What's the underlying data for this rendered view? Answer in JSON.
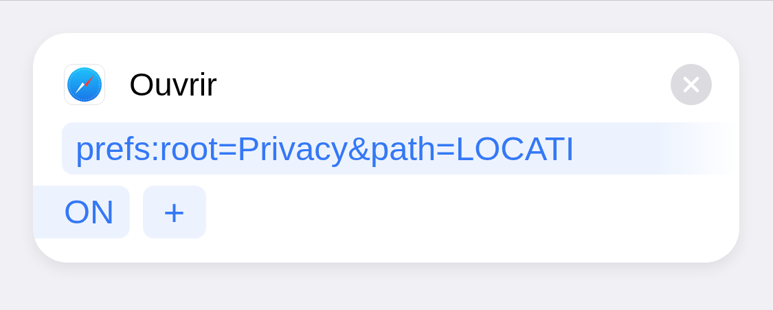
{
  "action": {
    "title": "Ouvrir",
    "url_parts": [
      {
        "text": "prefs:root=Privacy&path=LOCATI"
      },
      {
        "text": "ON"
      }
    ],
    "add_label": "+"
  }
}
